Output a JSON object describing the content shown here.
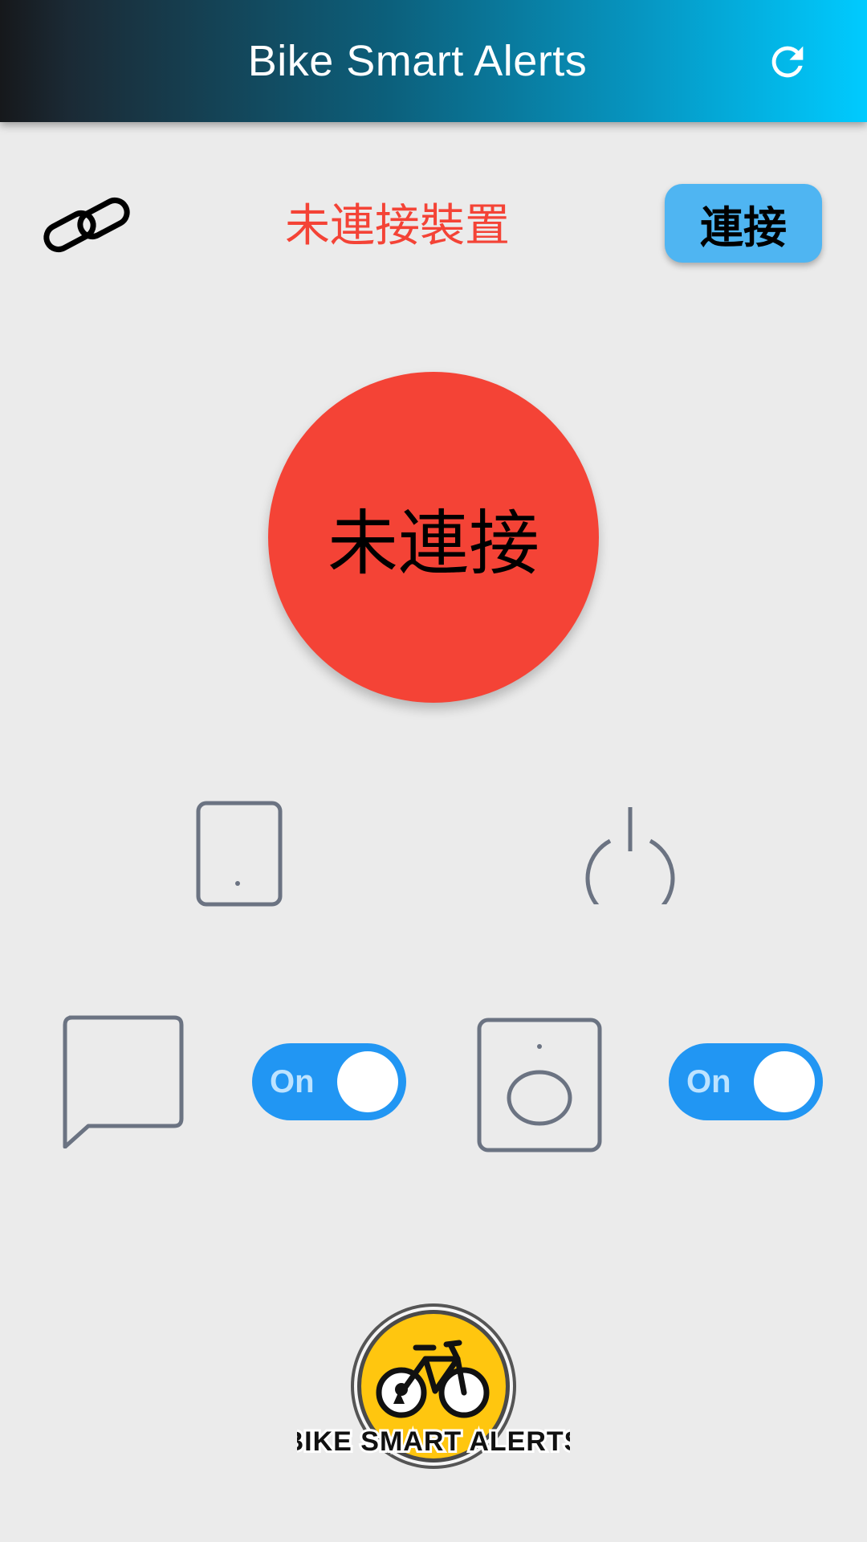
{
  "header": {
    "title": "Bike Smart Alerts",
    "refresh_icon": "refresh-icon"
  },
  "connection": {
    "link_icon": "link-icon",
    "status_text": "未連接裝置",
    "connect_label": "連接",
    "big_status_label": "未連接"
  },
  "controls": {
    "row1": [
      {
        "icon": "phone-icon"
      },
      {
        "icon": "power-icon"
      }
    ],
    "row2": [
      {
        "icon": "message-icon",
        "toggle_label": "On",
        "toggle_state": true
      },
      {
        "icon": "speaker-icon",
        "toggle_label": "On",
        "toggle_state": true
      }
    ]
  },
  "logo": {
    "text": "BIKE SMART ALERTS",
    "icon": "bicycle-lock-logo"
  },
  "colors": {
    "status_red": "#f44336",
    "connect_button": "#4fb5f2",
    "toggle_on": "#2196f3",
    "icon_gray": "#6b7382",
    "logo_yellow": "#ffc60f",
    "background": "#ebebeb"
  }
}
